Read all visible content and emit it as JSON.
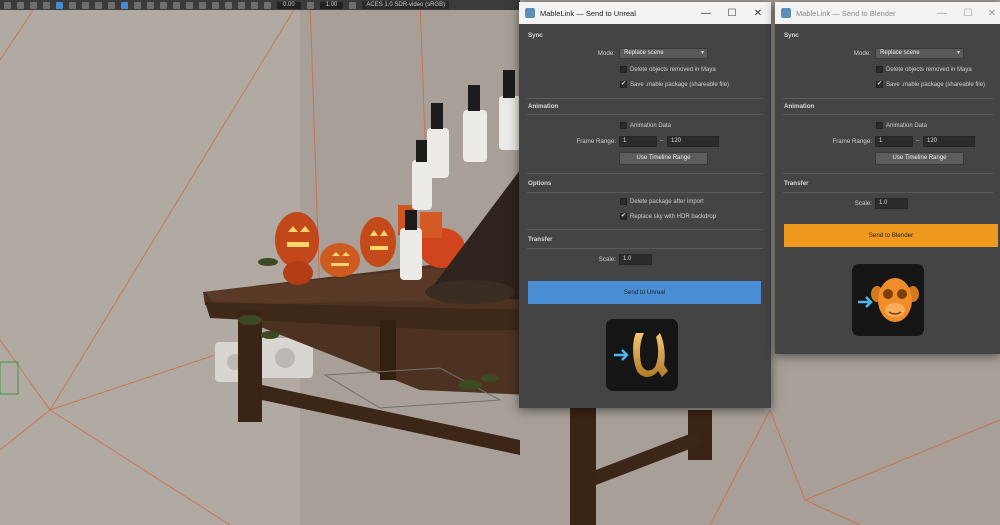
{
  "toolbar": {
    "value_a": "0.00",
    "value_b": "1.00",
    "colorspace": "ACES 1.0 SDR-video (sRGB)"
  },
  "unreal_window": {
    "title": "MableLink — Send to Unreal",
    "sections": {
      "sync": "Sync",
      "animation": "Animation",
      "options": "Options",
      "transfer": "Transfer"
    },
    "mode_label": "Mode:",
    "mode_value": "Replace scene",
    "delete_objects_label": "Delete objects removed in Maya",
    "save_package_label": "Save .mable package (shareable file)",
    "animation_data_label": "Animation Data",
    "frame_range_label": "Frame Range:",
    "frame_start": "1",
    "frame_dash": "–",
    "frame_end": "120",
    "use_timeline_label": "Use Timeline Range",
    "delete_package_label": "Delete package after import",
    "replace_sky_label": "Replace sky with HDR backdrop",
    "scale_label": "Scale:",
    "scale_value": "1.0",
    "send_button": "Send to Unreal",
    "checks": {
      "delete_objects": false,
      "save_package": true,
      "animation_data": false,
      "delete_package": false,
      "replace_sky": true
    },
    "accent_color": "#4a8fd6"
  },
  "blender_window": {
    "title": "MableLink — Send to Blender",
    "sections": {
      "sync": "Sync",
      "animation": "Animation",
      "transfer": "Transfer"
    },
    "mode_label": "Mode:",
    "mode_value": "Replace scene",
    "delete_objects_label": "Delete objects removed in Maya",
    "save_package_label": "Save .mable package (shareable file)",
    "animation_data_label": "Animation Data",
    "frame_range_label": "Frame Range:",
    "frame_start": "1",
    "frame_dash": "–",
    "frame_end": "120",
    "use_timeline_label": "Use Timeline Range",
    "scale_label": "Scale:",
    "scale_value": "1.0",
    "send_button": "Send to Blender",
    "checks": {
      "delete_objects": false,
      "save_package": true,
      "animation_data": false
    },
    "accent_color": "#ef9a1f"
  },
  "icons": {
    "checkmark": "✔",
    "dropdown_arrow": "▾",
    "minimize": "—",
    "maximize": "☐",
    "close": "✕"
  }
}
